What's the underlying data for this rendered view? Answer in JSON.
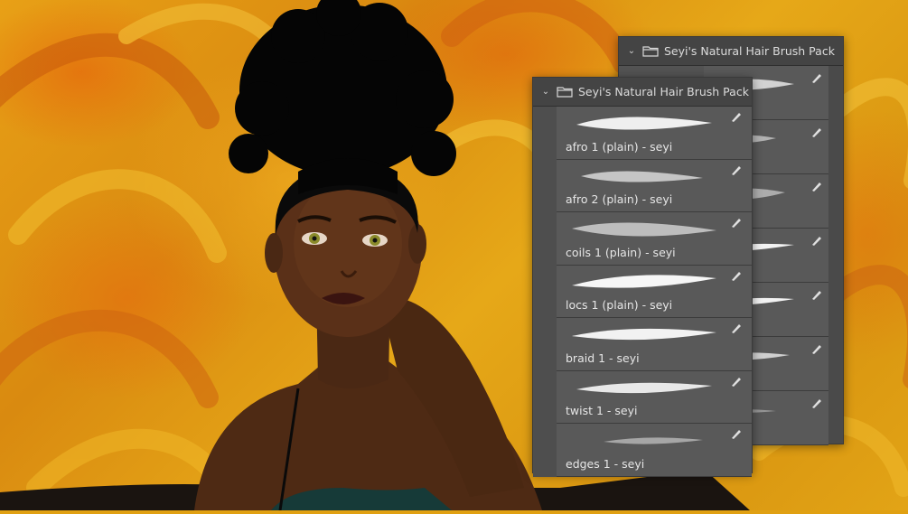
{
  "panels": {
    "back": {
      "title": "Seyi's Natural Hair Brush Pack",
      "items": [
        {
          "icon": "brush-stroke-icon"
        },
        {
          "icon": "brush-stroke-icon"
        },
        {
          "icon": "brush-stroke-icon"
        },
        {
          "icon": "brush-stroke-icon"
        },
        {
          "icon": "brush-stroke-icon"
        },
        {
          "icon": "brush-stroke-icon"
        },
        {
          "icon": "brush-stroke-icon"
        }
      ]
    },
    "front": {
      "title": "Seyi's Natural Hair Brush Pack",
      "items": [
        {
          "label": "afro 1 (plain) - seyi"
        },
        {
          "label": "afro 2 (plain) - seyi"
        },
        {
          "label": "coils 1 (plain) - seyi"
        },
        {
          "label": "locs 1 (plain) - seyi"
        },
        {
          "label": "braid 1 - seyi"
        },
        {
          "label": "twist 1 - seyi"
        },
        {
          "label": "edges 1 - seyi"
        }
      ]
    }
  },
  "icons": {
    "folder": "folder-icon",
    "chevron": "chevron-down-icon",
    "pen": "pen-edit-icon"
  },
  "colors": {
    "panel_bg": "#535353",
    "panel_header": "#444444",
    "background_orange": "#e0a012",
    "skin": "#5a3018",
    "hair": "#0a0a0a"
  }
}
